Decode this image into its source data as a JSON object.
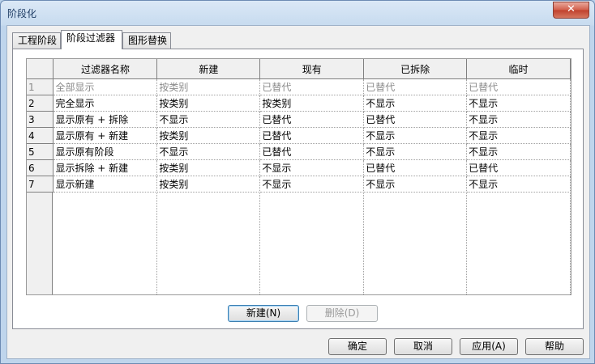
{
  "window": {
    "title": "阶段化",
    "close_glyph": "✕"
  },
  "tabs": [
    {
      "label": "工程阶段"
    },
    {
      "label": "阶段过滤器"
    },
    {
      "label": "图形替换"
    }
  ],
  "grid": {
    "columns": [
      "过滤器名称",
      "新建",
      "现有",
      "已拆除",
      "临时"
    ],
    "rows": [
      {
        "num": "1",
        "name": "全部显示",
        "new": "按类别",
        "existing": "已替代",
        "demolished": "已替代",
        "temporary": "已替代",
        "disabled": true
      },
      {
        "num": "2",
        "name": "完全显示",
        "new": "按类别",
        "existing": "按类别",
        "demolished": "不显示",
        "temporary": "不显示"
      },
      {
        "num": "3",
        "name": "显示原有 + 拆除",
        "new": "不显示",
        "existing": "已替代",
        "demolished": "已替代",
        "temporary": "不显示"
      },
      {
        "num": "4",
        "name": "显示原有 + 新建",
        "new": "按类别",
        "existing": "已替代",
        "demolished": "不显示",
        "temporary": "不显示"
      },
      {
        "num": "5",
        "name": "显示原有阶段",
        "new": "不显示",
        "existing": "已替代",
        "demolished": "不显示",
        "temporary": "不显示"
      },
      {
        "num": "6",
        "name": "显示拆除 + 新建",
        "new": "按类别",
        "existing": "不显示",
        "demolished": "已替代",
        "temporary": "已替代"
      },
      {
        "num": "7",
        "name": "显示新建",
        "new": "按类别",
        "existing": "不显示",
        "demolished": "不显示",
        "temporary": "不显示"
      }
    ]
  },
  "panel_buttons": {
    "new": "新建(N)",
    "delete": "删除(D)"
  },
  "footer_buttons": {
    "ok": "确定",
    "cancel": "取消",
    "apply": "应用(A)",
    "help": "帮助"
  }
}
